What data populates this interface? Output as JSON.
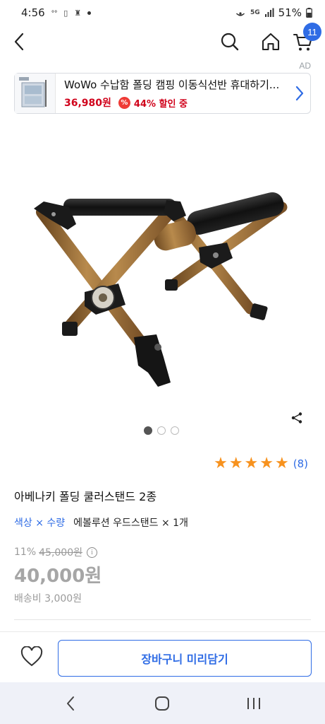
{
  "status_bar": {
    "time": "4:56",
    "battery": "51%",
    "network": "5G"
  },
  "header": {
    "cart_count": "11"
  },
  "ad": {
    "label": "AD",
    "title": "WoWo 수납함 폴딩 캠핑 이동식선반 휴대하기...",
    "price": "36,980원",
    "discount": "44% 할인 중",
    "discount_icon_text": "%"
  },
  "product": {
    "rating_stars": 5,
    "review_count": "(8)",
    "title": "아베나키 폴딩 쿨러스탠드 2종",
    "option_label": "색상 × 수량",
    "option_value": "에볼루션 우드스탠드 × 1개",
    "discount_rate": "11%",
    "original_price": "45,000원",
    "sale_price": "40,000원",
    "shipping": "배송비 3,000원",
    "image_count": 3,
    "image_index": 0
  },
  "actions": {
    "add_to_cart": "장바구니 미리담기"
  },
  "colors": {
    "accent": "#2f6ce5",
    "star": "#f7921e",
    "sale_red": "#d0021b"
  },
  "icons": [
    "back-icon",
    "search-icon",
    "home-icon",
    "cart-icon",
    "share-icon",
    "heart-icon",
    "info-icon"
  ]
}
